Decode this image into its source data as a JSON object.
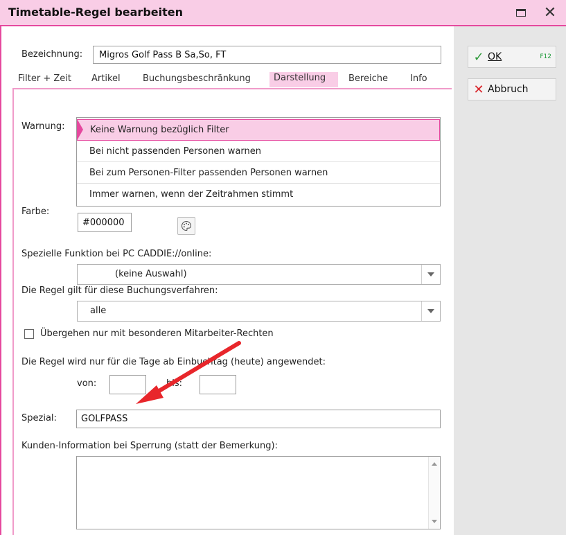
{
  "window": {
    "title": "Timetable-Regel bearbeiten",
    "maximize_icon": "maximize-icon",
    "close_glyph": "✕"
  },
  "side": {
    "ok_label": "OK",
    "ok_shortcut": "F12",
    "cancel_label": "Abbruch"
  },
  "form": {
    "name_label": "Bezeichnung:",
    "name_value": "Migros Golf Pass B Sa,So, FT"
  },
  "tabs": [
    {
      "label": "Filter + Zeit"
    },
    {
      "label": "Artikel"
    },
    {
      "label": "Buchungsbeschränkung"
    },
    {
      "label": "Darstellung",
      "active": true
    },
    {
      "label": "Bereiche"
    },
    {
      "label": "Info"
    }
  ],
  "warning": {
    "label": "Warnung:",
    "options": [
      "Keine Warnung bezüglich Filter",
      "Bei nicht passenden Personen warnen",
      "Bei zum Personen-Filter passenden Personen warnen",
      "Immer warnen, wenn der Zeitrahmen stimmt"
    ],
    "selected_index": 0
  },
  "color": {
    "label": "Farbe:",
    "value": "#000000"
  },
  "online": {
    "label": "Spezielle Funktion bei PC CADDIE://online:",
    "value": "(keine Auswahl)"
  },
  "booking": {
    "label": "Die Regel gilt für diese Buchungsverfahren:",
    "value": "alle"
  },
  "override": {
    "label": "Übergehen nur mit besonderen Mitarbeiter-Rechten",
    "checked": false
  },
  "days": {
    "label": "Die Regel wird nur für die Tage ab Einbuchtag (heute) angewendet:",
    "from_label": "von:",
    "to_label": "bis:",
    "from_value": "",
    "to_value": ""
  },
  "special": {
    "label": "Spezial:",
    "value": "GOLFPASS"
  },
  "customer_info": {
    "label": "Kunden-Information bei Sperrung (statt der Bemerkung):",
    "value": ""
  },
  "colors": {
    "accent": "#e5489e",
    "accent_light": "#f9cde6",
    "annotation_arrow": "#e8262b"
  }
}
